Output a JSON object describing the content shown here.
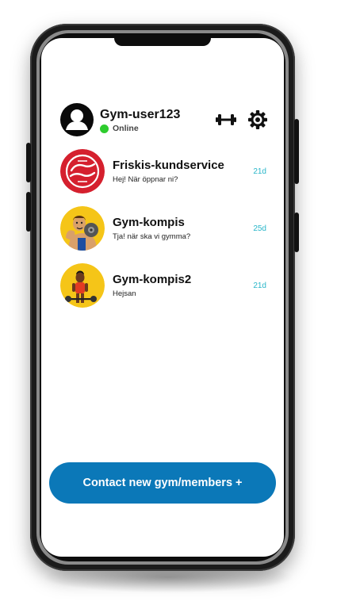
{
  "user": {
    "username": "Gym-user123",
    "status": "Online"
  },
  "header_icons": [
    "dumbbell-icon",
    "gear-icon"
  ],
  "chats": [
    {
      "name": "Friskis-kundservice",
      "message": "Hej! När öppnar ni?",
      "time": "21d",
      "avatar": "friskis-logo"
    },
    {
      "name": "Gym-kompis",
      "message": "Tja! när ska vi gymma?",
      "time": "25d",
      "avatar": "muscle-man-avatar"
    },
    {
      "name": "Gym-kompis2",
      "message": "Hejsan",
      "time": "21d",
      "avatar": "weightlifter-avatar"
    }
  ],
  "contact_button": {
    "label": "Contact new gym/members +"
  },
  "colors": {
    "accent": "#0b78b8",
    "online": "#2ecc2e",
    "timestamp": "#29b6c9",
    "friskis_red": "#d5202e",
    "avatar_yellow": "#f5c518"
  }
}
